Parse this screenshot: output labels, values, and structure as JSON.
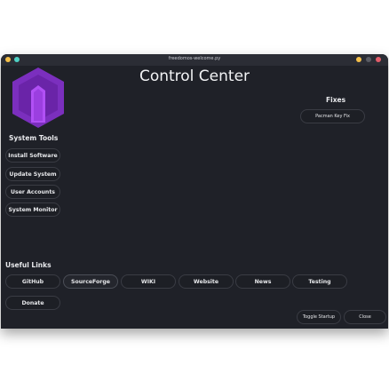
{
  "window": {
    "title": "freedomos-welcome.py"
  },
  "header": {
    "title": "Control Center"
  },
  "fixes": {
    "title": "Fixes",
    "buttons": [
      "Pacman Key Fix"
    ]
  },
  "system_tools": {
    "title": "System Tools",
    "buttons": [
      "Install Software",
      "Update System",
      "User Accounts",
      "System Monitor"
    ]
  },
  "useful_links": {
    "title": "Useful Links",
    "buttons": [
      "GitHub",
      "SourceForge",
      "WIKI",
      "Website",
      "News",
      "Testing",
      "Donate"
    ]
  },
  "footer": {
    "toggle_startup": "Toggle Startup",
    "close": "Close"
  },
  "colors": {
    "background": "#1f2128",
    "titlebar": "#2b2d35",
    "logo_outer": "#7b2fbe",
    "logo_inner": "#9b3fe0",
    "dot_yellow": "#f5c04a",
    "dot_cyan": "#4fd1c5",
    "dot_red": "#e35d6a"
  }
}
